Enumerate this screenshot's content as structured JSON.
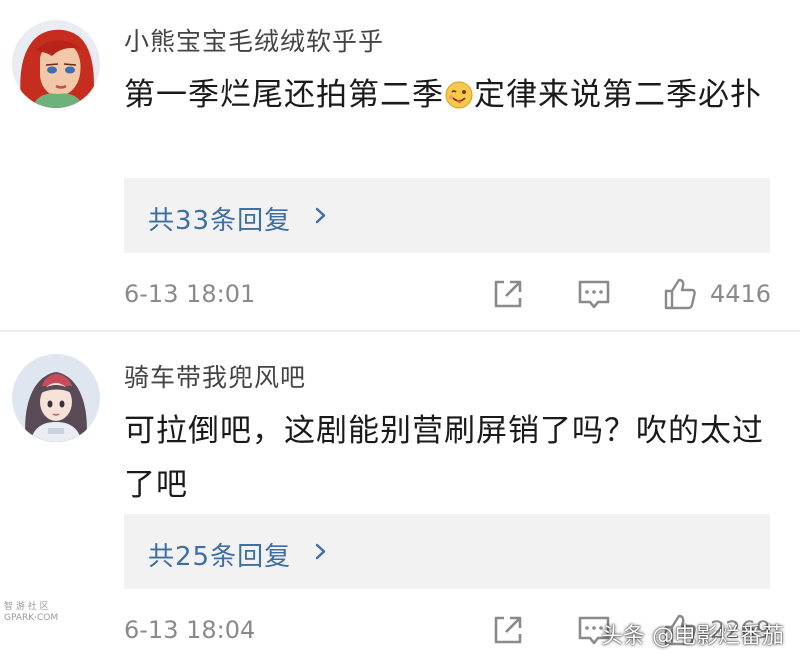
{
  "comments": [
    {
      "username": "小熊宝宝毛绒绒软乎乎",
      "text_before_emoji": "第一季烂尾还拍第二季",
      "emoji": "wink-tongue-emoji",
      "text_after_emoji": "定律来说第二季必扑",
      "reply_label": "共33条回复",
      "time": "6-13 18:01",
      "like_count": "4416",
      "avatar": "red-hair-cartoon-avatar"
    },
    {
      "username": "骑车带我兜风吧",
      "text": "可拉倒吧，这剧能别营刷屏销了吗？吹的太过了吧",
      "reply_label": "共25条回复",
      "time": "6-13 18:04",
      "like_count": "2269",
      "avatar": "anime-girl-avatar"
    }
  ],
  "watermark": "头条 @电影烂番茄",
  "site_mark": {
    "line1": "智 游 社 区",
    "line2": "GPARK·COM"
  },
  "icons": [
    "share-icon",
    "comment-icon",
    "thumbs-up-icon",
    "chevron-right-icon"
  ],
  "colors": {
    "reply_link": "#3f6ea3",
    "reply_bg": "#f2f2f2",
    "meta_text": "#8a8a8a"
  }
}
